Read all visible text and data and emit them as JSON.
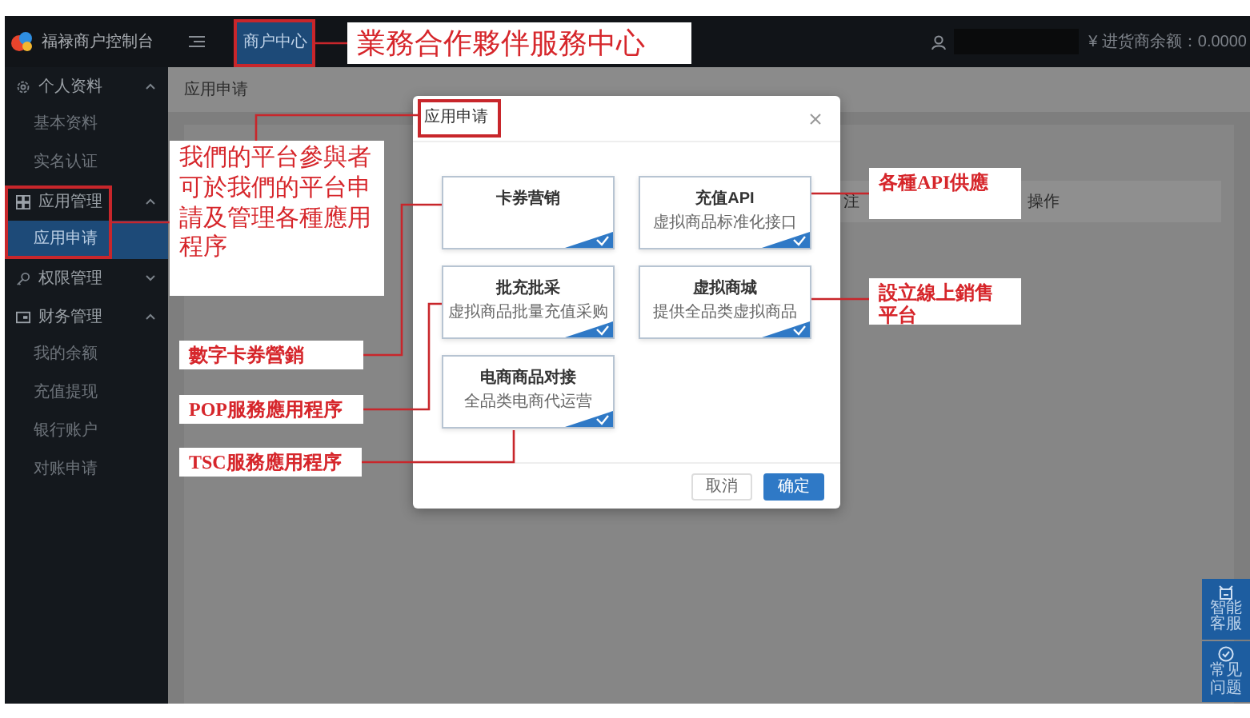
{
  "sidebar": {
    "brand": "福禄商户控制台",
    "groups": [
      {
        "label": "个人资料",
        "expanded": true,
        "items": [
          {
            "label": "基本资料",
            "selected": false
          },
          {
            "label": "实名认证",
            "selected": false
          }
        ]
      },
      {
        "label": "应用管理",
        "expanded": true,
        "items": [
          {
            "label": "应用申请",
            "selected": true
          }
        ]
      },
      {
        "label": "权限管理",
        "expanded": false
      },
      {
        "label": "财务管理",
        "expanded": true,
        "items": [
          {
            "label": "我的余额",
            "selected": false
          },
          {
            "label": "充值提现",
            "selected": false
          },
          {
            "label": "银行账户",
            "selected": false
          },
          {
            "label": "对账申请",
            "selected": false
          }
        ]
      }
    ]
  },
  "topbar": {
    "tabs": [
      {
        "label": "商户中心",
        "selected": true
      }
    ],
    "balance": "¥ 进货商余额：0.0000"
  },
  "breadcrumb": "应用申请",
  "table": {
    "columns": [
      "注",
      "操作"
    ]
  },
  "modal": {
    "title": "应用申请",
    "cards": [
      {
        "title": "卡券营销",
        "checked": true
      },
      {
        "title": "充值API",
        "subtitle": "虚拟商品标准化接口",
        "checked": true
      },
      {
        "title": "批充批采",
        "subtitle": "虚拟商品批量充值采购",
        "checked": true
      },
      {
        "title": "虚拟商城",
        "subtitle": "提供全品类虚拟商品",
        "checked": true
      },
      {
        "title": "电商商品对接",
        "subtitle": "全品类电商代运营",
        "checked": true
      }
    ],
    "buttons": [
      {
        "label": "取消",
        "kind": "secondary"
      },
      {
        "label": "确定",
        "kind": "primary"
      }
    ]
  },
  "float_buttons": [
    {
      "label": "智能客服"
    },
    {
      "label": "常见问题"
    }
  ],
  "annotations": [
    {
      "text": "業務合作夥伴服務中心"
    },
    {
      "text": "我們的平台參與者可於我們的平台申請及管理各種應用程序"
    },
    {
      "text": "數字卡券營銷"
    },
    {
      "text": "POP服務應用程序"
    },
    {
      "text": "TSC服務應用程序"
    },
    {
      "text": "各種API供應"
    },
    {
      "text": "設立線上銷售平台"
    }
  ]
}
